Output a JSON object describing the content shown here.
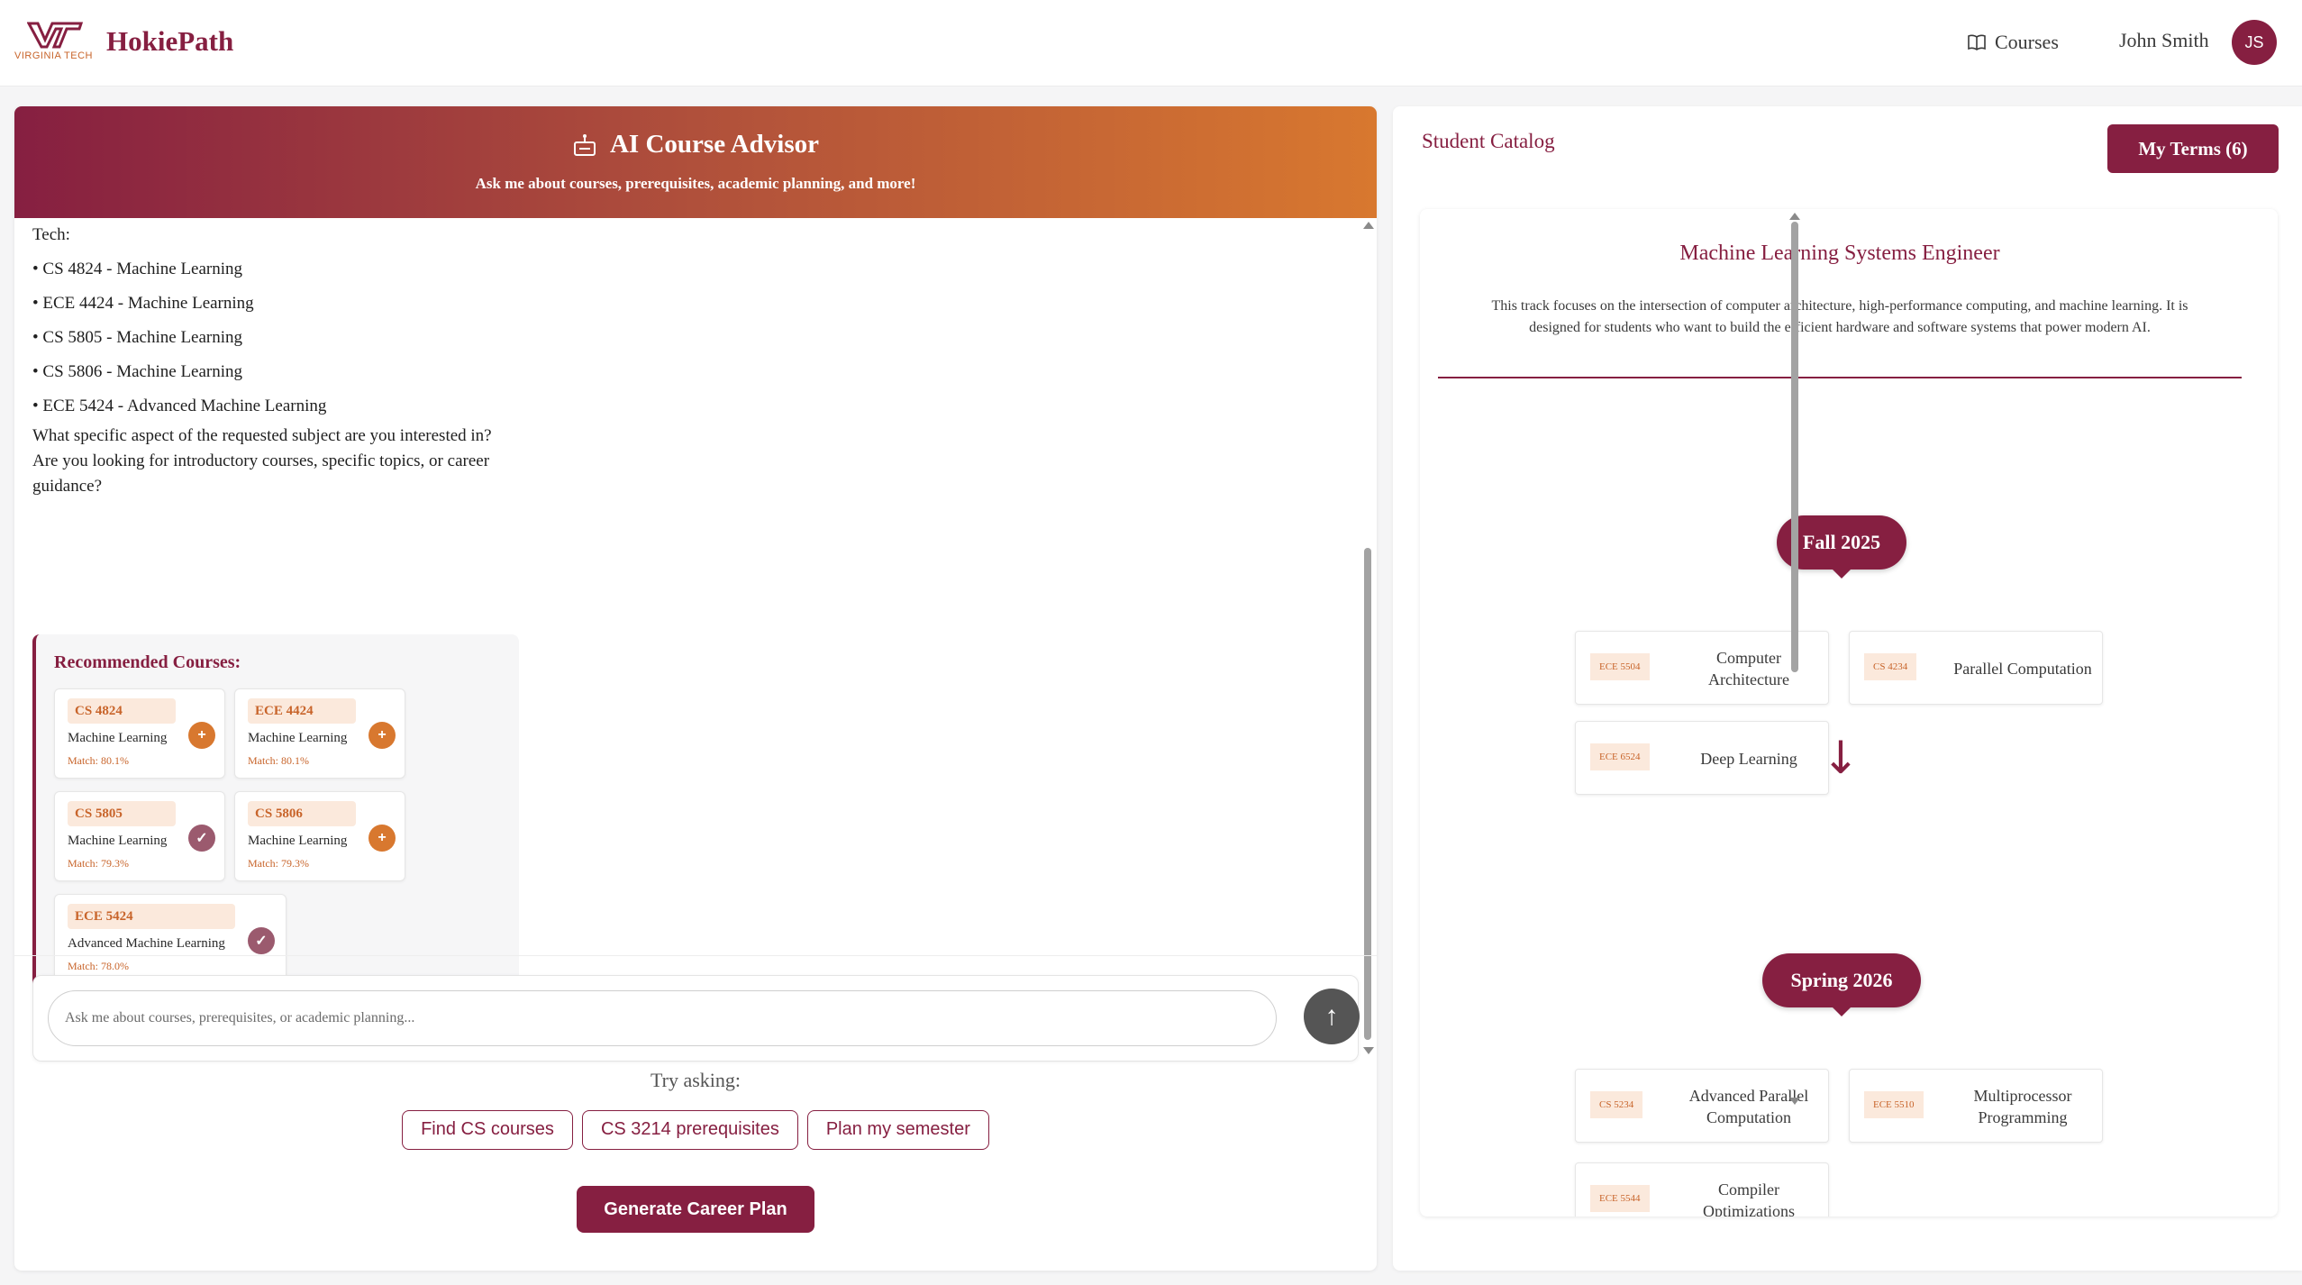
{
  "header": {
    "logo_word": "VIRGINIA TECH",
    "brand": "HokiePath",
    "nav_courses": "Courses",
    "user_name": "John Smith",
    "user_initials": "JS"
  },
  "advisor": {
    "title": "AI Course Advisor",
    "subtitle": "Ask me about courses, prerequisites, academic planning, and more!"
  },
  "chat": {
    "lead": "Tech:",
    "bullets": [
      "• CS 4824 - Machine Learning",
      "• ECE 4424 - Machine Learning",
      "• CS 5805 - Machine Learning",
      "• CS 5806 - Machine Learning",
      "• ECE 5424 - Advanced Machine Learning"
    ],
    "question": "What specific aspect of the requested subject are you interested in? Are you looking for introductory courses, specific topics, or career guidance?",
    "recommended_title": "Recommended Courses:",
    "recommended": [
      {
        "code": "CS 4824",
        "name": "Machine Learning",
        "match": "Match: 80.1%",
        "state": "add"
      },
      {
        "code": "ECE 4424",
        "name": "Machine Learning",
        "match": "Match: 80.1%",
        "state": "add"
      },
      {
        "code": "CS 5805",
        "name": "Machine Learning",
        "match": "Match: 79.3%",
        "state": "added"
      },
      {
        "code": "CS 5806",
        "name": "Machine Learning",
        "match": "Match: 79.3%",
        "state": "add"
      },
      {
        "code": "ECE 5424",
        "name": "Advanced Machine Learning",
        "match": "Match: 78.0%",
        "state": "added"
      }
    ]
  },
  "composer": {
    "placeholder": "Ask me about courses, prerequisites, or academic planning...",
    "send_icon": "↑"
  },
  "suggestions": {
    "label": "Try asking:",
    "chips": [
      "Find CS courses",
      "CS 3214 prerequisites",
      "Plan my semester"
    ]
  },
  "career_button": "Generate Career Plan",
  "catalog": {
    "title": "Student Catalog",
    "my_terms": "My Terms (6)",
    "track_title": "Machine Learning Systems Engineer",
    "track_desc": "This track focuses on the intersection of computer architecture, high-performance computing, and machine learning. It is designed for students who want to build the efficient hardware and software systems that power modern AI.",
    "terms": [
      {
        "name": "Fall 2025",
        "courses": [
          {
            "code": "ECE 5504",
            "name": "Computer Architecture"
          },
          {
            "code": "CS 4234",
            "name": "Parallel Computation"
          },
          {
            "code": "ECE 6524",
            "name": "Deep Learning"
          }
        ]
      },
      {
        "name": "Spring 2026",
        "courses": [
          {
            "code": "CS 5234",
            "name": "Advanced Parallel Computation"
          },
          {
            "code": "ECE 5510",
            "name": "Multiprocessor Programming"
          },
          {
            "code": "ECE 5544",
            "name": "Compiler Optimizations"
          }
        ]
      }
    ],
    "arrow": "↓"
  },
  "icons": {
    "logo": "vt-logo-icon",
    "courses": "book-icon",
    "advisor": "robot-icon",
    "add": "plus-icon",
    "added": "check-icon",
    "send": "arrow-up-icon"
  },
  "colors": {
    "maroon": "#861f41",
    "orange": "#d8782f",
    "chip_bg": "#fbe9dc"
  }
}
